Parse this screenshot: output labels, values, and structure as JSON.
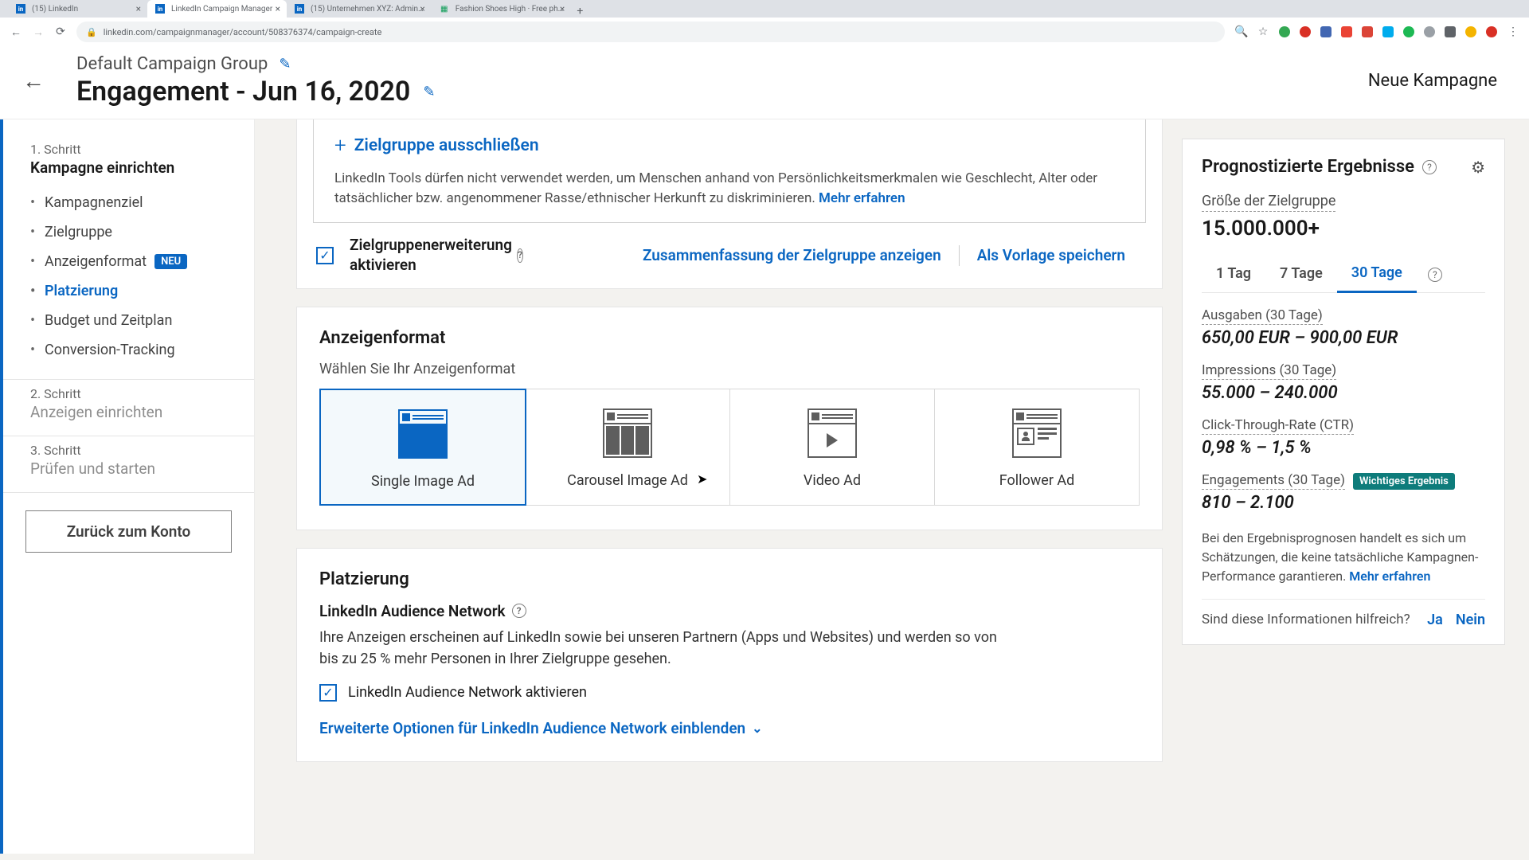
{
  "browser": {
    "tabs": [
      {
        "title": "(15) LinkedIn",
        "favicon": "in",
        "color": "#0a66c2"
      },
      {
        "title": "LinkedIn Campaign Manager",
        "favicon": "in",
        "color": "#0a66c2"
      },
      {
        "title": "(15) Unternehmen XYZ: Admin…",
        "favicon": "in",
        "color": "#0a66c2"
      },
      {
        "title": "Fashion Shoes High · Free ph…",
        "favicon": "▦",
        "color": "#0f9d58"
      }
    ],
    "url": "linkedin.com/campaignmanager/account/508376374/campaign-create"
  },
  "header": {
    "group_name": "Default Campaign Group",
    "campaign_name": "Engagement - Jun 16, 2020",
    "new_campaign": "Neue Kampagne"
  },
  "sidebar": {
    "steps": [
      {
        "num": "1. Schritt",
        "title": "Kampagne einrichten",
        "items": [
          {
            "label": "Kampagnenziel"
          },
          {
            "label": "Zielgruppe"
          },
          {
            "label": "Anzeigenformat",
            "badge": "NEU"
          },
          {
            "label": "Platzierung",
            "active": true
          },
          {
            "label": "Budget und Zeitplan"
          },
          {
            "label": "Conversion-Tracking"
          }
        ]
      },
      {
        "num": "2. Schritt",
        "title": "Anzeigen einrichten"
      },
      {
        "num": "3. Schritt",
        "title": "Prüfen und starten"
      }
    ],
    "back_button": "Zurück zum Konto"
  },
  "audience": {
    "exclude": "Zielgruppe ausschließen",
    "disclaimer": "LinkedIn Tools dürfen nicht verwendet werden, um Menschen anhand von Persönlichkeitsmerkmalen wie Geschlecht, Alter oder tatsächlicher bzw. angenommener Rasse/ethnischer Herkunft zu diskriminieren. ",
    "learn_more": "Mehr erfahren",
    "expansion_label": "Zielgruppenerweiterung aktivieren",
    "summary": "Zusammenfassung der Zielgruppe anzeigen",
    "save_template": "Als Vorlage speichern"
  },
  "format": {
    "title": "Anzeigenformat",
    "subtitle": "Wählen Sie Ihr Anzeigenformat",
    "options": [
      "Single Image Ad",
      "Carousel Image Ad",
      "Video Ad",
      "Follower Ad"
    ]
  },
  "placement": {
    "title": "Platzierung",
    "lan_title": "LinkedIn Audience Network",
    "lan_desc": "Ihre Anzeigen erscheinen auf LinkedIn sowie bei unseren Partnern (Apps und Websites) und werden so von bis zu 25 % mehr Personen in Ihrer Zielgruppe gesehen.",
    "lan_check": "LinkedIn Audience Network aktivieren",
    "expand": "Erweiterte Optionen für LinkedIn Audience Network einblenden"
  },
  "forecast": {
    "title": "Prognostizierte Ergebnisse",
    "audience_label": "Größe der Zielgruppe",
    "audience_size": "15.000.000+",
    "day_tabs": [
      "1 Tag",
      "7 Tage",
      "30 Tage"
    ],
    "metrics": [
      {
        "label": "Ausgaben (30 Tage)",
        "value": "650,00 EUR – 900,00 EUR"
      },
      {
        "label": "Impressions (30 Tage)",
        "value": "55.000 – 240.000"
      },
      {
        "label": "Click-Through-Rate (CTR)",
        "value": "0,98 % – 1,5 %"
      },
      {
        "label": "Engagements (30 Tage)",
        "value": "810 – 2.100",
        "key_badge": "Wichtiges Ergebnis"
      }
    ],
    "footer": "Bei den Ergebnisprognosen handelt es sich um Schätzungen, die keine tatsächliche Kampagnen-Performance garantieren. ",
    "learn_more": "Mehr erfahren",
    "helpful_q": "Sind diese Informationen hilfreich?",
    "yes": "Ja",
    "no": "Nein"
  }
}
